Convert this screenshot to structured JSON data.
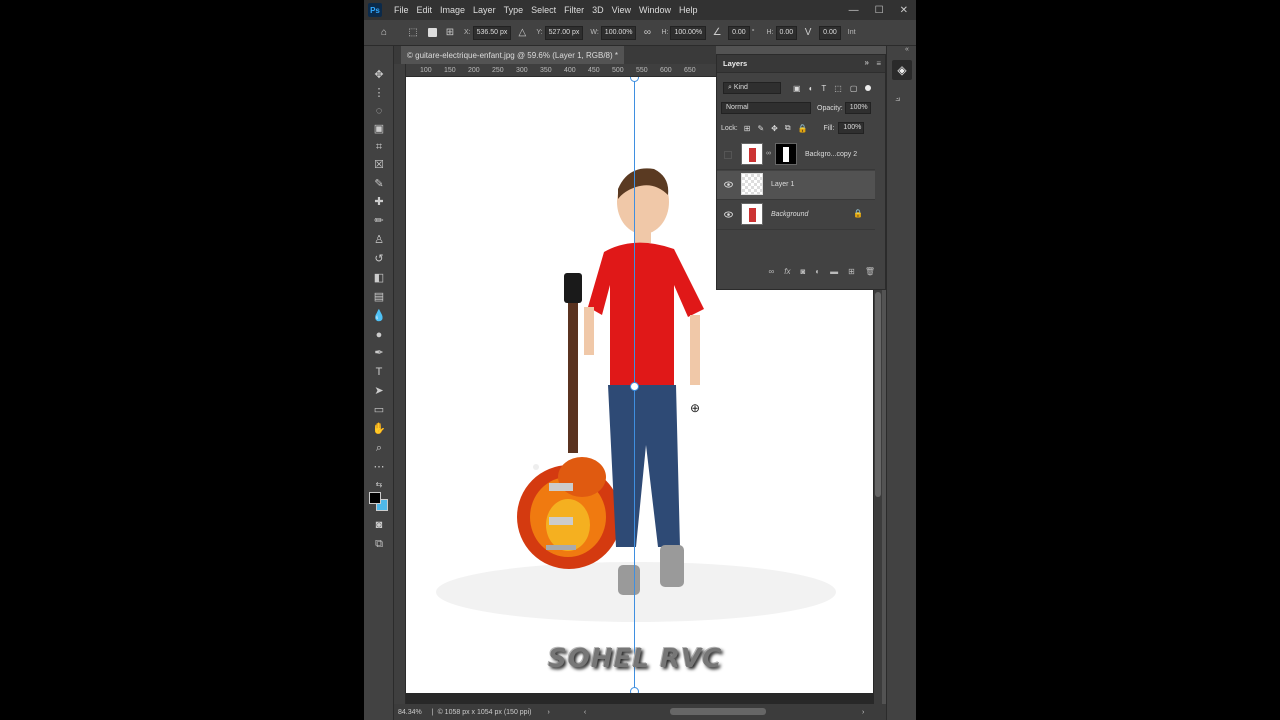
{
  "app": {
    "logo_text": "Ps"
  },
  "menu": [
    "File",
    "Edit",
    "Image",
    "Layer",
    "Type",
    "Select",
    "Filter",
    "3D",
    "View",
    "Window",
    "Help"
  ],
  "window_controls": [
    "—",
    "☐",
    "✕"
  ],
  "options_bar": {
    "x_label": "X:",
    "x_value": "536.50 px",
    "y_label": "Y:",
    "y_value": "527.00 px",
    "w_label": "W:",
    "w_value": "100.00%",
    "h_label": "H:",
    "h_value": "100.00%",
    "angle_value": "0.00",
    "angle_unit": "°",
    "hskew_label": "H:",
    "hskew_value": "0.00",
    "vskew_value": "0.00",
    "interp_label": "Int"
  },
  "document": {
    "tab_title": "© guitare-electrique-enfant.jpg @ 59.6% (Layer 1, RGB/8) *",
    "watermark_text": "SOHEL RVC"
  },
  "rulers": {
    "top_ticks": [
      "100",
      "150",
      "200",
      "250",
      "300",
      "350",
      "400",
      "450",
      "500",
      "550",
      "600",
      "650"
    ]
  },
  "status_bar": {
    "zoom": "84.34%",
    "doc_info": "© 1058 px x 1054 px (150 ppi)"
  },
  "layers_panel": {
    "title": "Layers",
    "filter_kind": "Kind",
    "blend_mode": "Normal",
    "opacity_label": "Opacity:",
    "opacity_value": "100%",
    "lock_label": "Lock:",
    "fill_label": "Fill:",
    "fill_value": "100%",
    "layers": [
      {
        "name": "Backgro...copy 2",
        "visible": false,
        "has_mask": true
      },
      {
        "name": "Layer 1",
        "visible": true,
        "selected": true
      },
      {
        "name": "Background",
        "visible": true,
        "locked": true
      }
    ]
  },
  "colors": {
    "accent_guide": "#3f8fe0",
    "foreground_swatch": "#000000",
    "background_swatch": "#4fb8ea"
  }
}
